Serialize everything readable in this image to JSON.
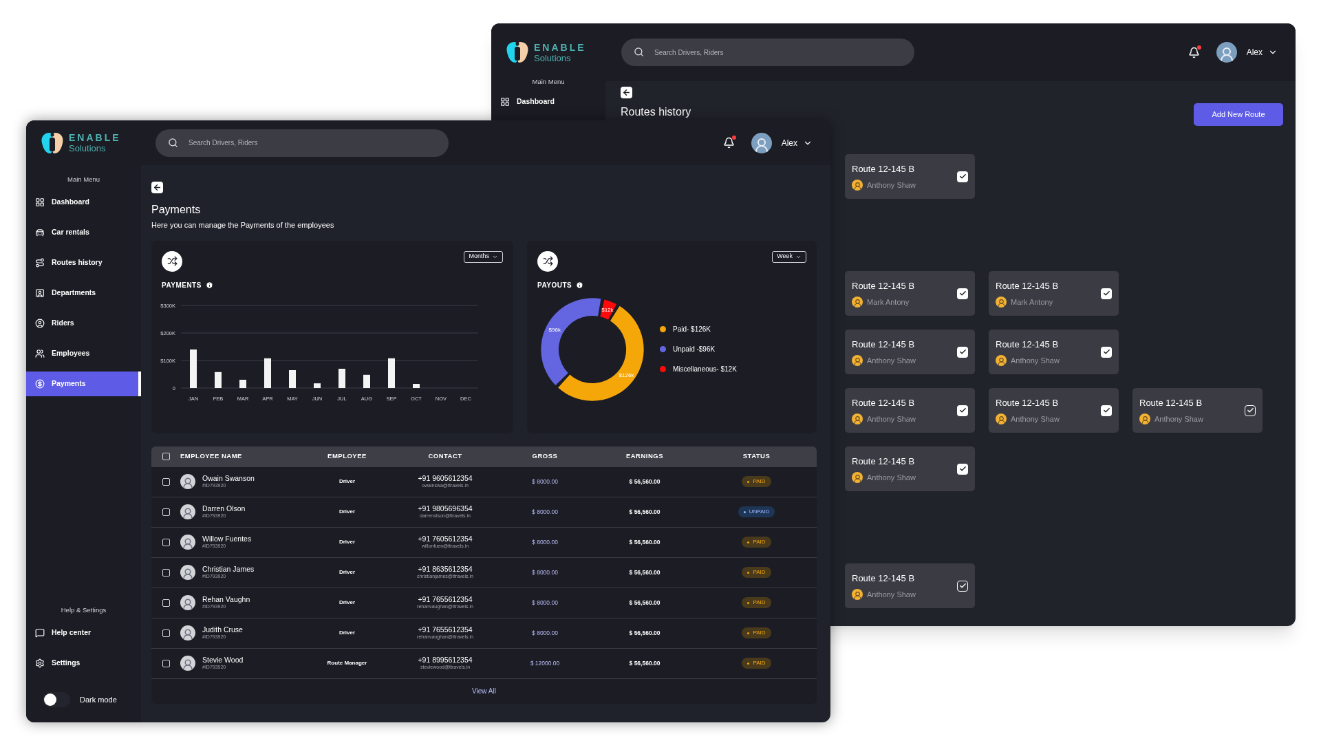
{
  "back_window": {
    "logo": {
      "name": "ENABLE",
      "tagline": "Solutions"
    },
    "search": {
      "placeholder": "Search Drivers, Riders"
    },
    "notifications": {
      "unread": true
    },
    "user": {
      "name": "Alex"
    },
    "menu_heading": "Main Menu",
    "nav": [
      {
        "label": "Dashboard",
        "selected": false
      }
    ],
    "page_title": "Routes history",
    "add_button": "Add New Route",
    "route_rows": [
      [
        {
          "title": "Route 12-145 B",
          "driver": "Anthony Shaw",
          "kind": "filled"
        }
      ],
      [
        {
          "title": "Route 12-145 B",
          "driver": "Mark Antony",
          "kind": "filled"
        },
        {
          "title": "Route 12-145 B",
          "driver": "Mark Antony",
          "kind": "filled"
        }
      ],
      [
        {
          "title": "Route 12-145 B",
          "driver": "Anthony Shaw",
          "kind": "filled"
        },
        {
          "title": "Route 12-145 B",
          "driver": "Anthony Shaw",
          "kind": "filled"
        }
      ],
      [
        {
          "title": "Route 12-145 B",
          "driver": "Anthony Shaw",
          "kind": "filled"
        },
        {
          "title": "Route 12-145 B",
          "driver": "Anthony Shaw",
          "kind": "filled"
        },
        {
          "title": "Route 12-145 B",
          "driver": "Anthony Shaw",
          "kind": "outlined"
        }
      ],
      [
        {
          "title": "Route 12-145 B",
          "driver": "Anthony Shaw",
          "kind": "filled"
        }
      ],
      [
        {
          "title": "Route 12-145 B",
          "driver": "Anthony Shaw",
          "kind": "outlined"
        }
      ]
    ]
  },
  "front_window": {
    "logo": {
      "name": "ENABLE",
      "tagline": "Solutions"
    },
    "search": {
      "placeholder": "Search Drivers, Riders"
    },
    "notifications": {
      "unread": true
    },
    "user": {
      "name": "Alex"
    },
    "menu_heading": "Main Menu",
    "nav": [
      {
        "label": "Dashboard",
        "selected": false
      },
      {
        "label": "Car rentals",
        "selected": false
      },
      {
        "label": "Routes history",
        "selected": false
      },
      {
        "label": "Departments",
        "selected": false
      },
      {
        "label": "Riders",
        "selected": false
      },
      {
        "label": "Employees",
        "selected": false
      },
      {
        "label": "Payments",
        "selected": true
      }
    ],
    "help_heading": "Help & Settings",
    "help_nav": [
      {
        "label": "Help center"
      },
      {
        "label": "Settings"
      }
    ],
    "dark_mode": {
      "label": "Dark mode",
      "on": false
    },
    "page_title": "Payments",
    "page_subtitle": "Here you can manage the Payments of the employees",
    "payments_panel": {
      "title": "PAYMENTS",
      "period": "Months",
      "chart_data": {
        "type": "bar",
        "categories": [
          "JAN",
          "FEB",
          "MAR",
          "APR",
          "MAY",
          "JUN",
          "JUL",
          "AUG",
          "SEP",
          "OCT",
          "NOV",
          "DEC"
        ],
        "values": [
          140,
          58,
          30,
          108,
          65,
          17,
          70,
          48,
          108,
          15,
          null,
          null
        ],
        "yticks": [
          {
            "value": 0,
            "label": "0"
          },
          {
            "value": 100,
            "label": "$100K"
          },
          {
            "value": 200,
            "label": "$200K"
          },
          {
            "value": 300,
            "label": "$300K"
          }
        ],
        "ylim": [
          0,
          300
        ]
      }
    },
    "payouts_panel": {
      "title": "PAYOUTS",
      "period": "Week",
      "chart_data": {
        "type": "donut",
        "categories": [
          "Paid- $126K",
          "Unpaid -$96K",
          "Miscellaneous- $12K"
        ],
        "values": [
          126,
          96,
          12
        ],
        "colors": [
          "#f5a70a",
          "#6366e0",
          "#ff0a0a"
        ],
        "value_labels": [
          "$126k",
          "$96k",
          "$12k"
        ]
      }
    },
    "table": {
      "select_all": {
        "checked": false
      },
      "columns": [
        "EMPLOYEE NAME",
        "EMPLOYEE",
        "CONTACT",
        "GROSS",
        "EARNINGS",
        "STATUS"
      ],
      "rows": [
        {
          "checked": false,
          "name": "Owain Swanson",
          "id": "#ID793920",
          "role": "Driver",
          "phone": "+91 9605612354",
          "email": "owainswa@ttravels.in",
          "gross": "$ 8000.00",
          "earnings": "$ 56,560.00",
          "status": {
            "label": "PAID",
            "kind": "paid"
          }
        },
        {
          "checked": false,
          "name": "Darren Olson",
          "id": "#ID793920",
          "role": "Driver",
          "phone": "+91 9805696354",
          "email": "darrenolson@ttravels.in",
          "gross": "$ 8000.00",
          "earnings": "$ 56,560.00",
          "status": {
            "label": "UNPAID",
            "kind": "unpaid"
          }
        },
        {
          "checked": false,
          "name": "Willow Fuentes",
          "id": "#ID793920",
          "role": "Driver",
          "phone": "+91 7605612354",
          "email": "willonfuen@ttravels.in",
          "gross": "$ 8000.00",
          "earnings": "$ 56,560.00",
          "status": {
            "label": "PAID",
            "kind": "paid"
          }
        },
        {
          "checked": false,
          "name": "Christian James",
          "id": "#ID793920",
          "role": "Driver",
          "phone": "+91 8635612354",
          "email": "christianjames@ttravels.in",
          "gross": "$ 8000.00",
          "earnings": "$ 56,560.00",
          "status": {
            "label": "PAID",
            "kind": "paid"
          }
        },
        {
          "checked": false,
          "name": "Rehan Vaughn",
          "id": "#ID793920",
          "role": "Driver",
          "phone": "+91 7655612354",
          "email": "rehanvaughan@ttravels.in",
          "gross": "$ 8000.00",
          "earnings": "$ 56,560.00",
          "status": {
            "label": "PAID",
            "kind": "paid"
          }
        },
        {
          "checked": false,
          "name": "Judith Cruse",
          "id": "#ID793920",
          "role": "Driver",
          "phone": "+91 7655612354",
          "email": "rehanvaughan@ttravels.in",
          "gross": "$ 8000.00",
          "earnings": "$ 56,560.00",
          "status": {
            "label": "PAID",
            "kind": "paid"
          }
        },
        {
          "checked": false,
          "name": "Stevie Wood",
          "id": "#ID793920",
          "role": "Route Manager",
          "phone": "+91 8995612354",
          "email": "steviewood@ttravels.in",
          "gross": "$ 12000.00",
          "earnings": "$ 56,560.00",
          "status": {
            "label": "PAID",
            "kind": "paid"
          }
        }
      ],
      "view_all": "View All"
    }
  }
}
